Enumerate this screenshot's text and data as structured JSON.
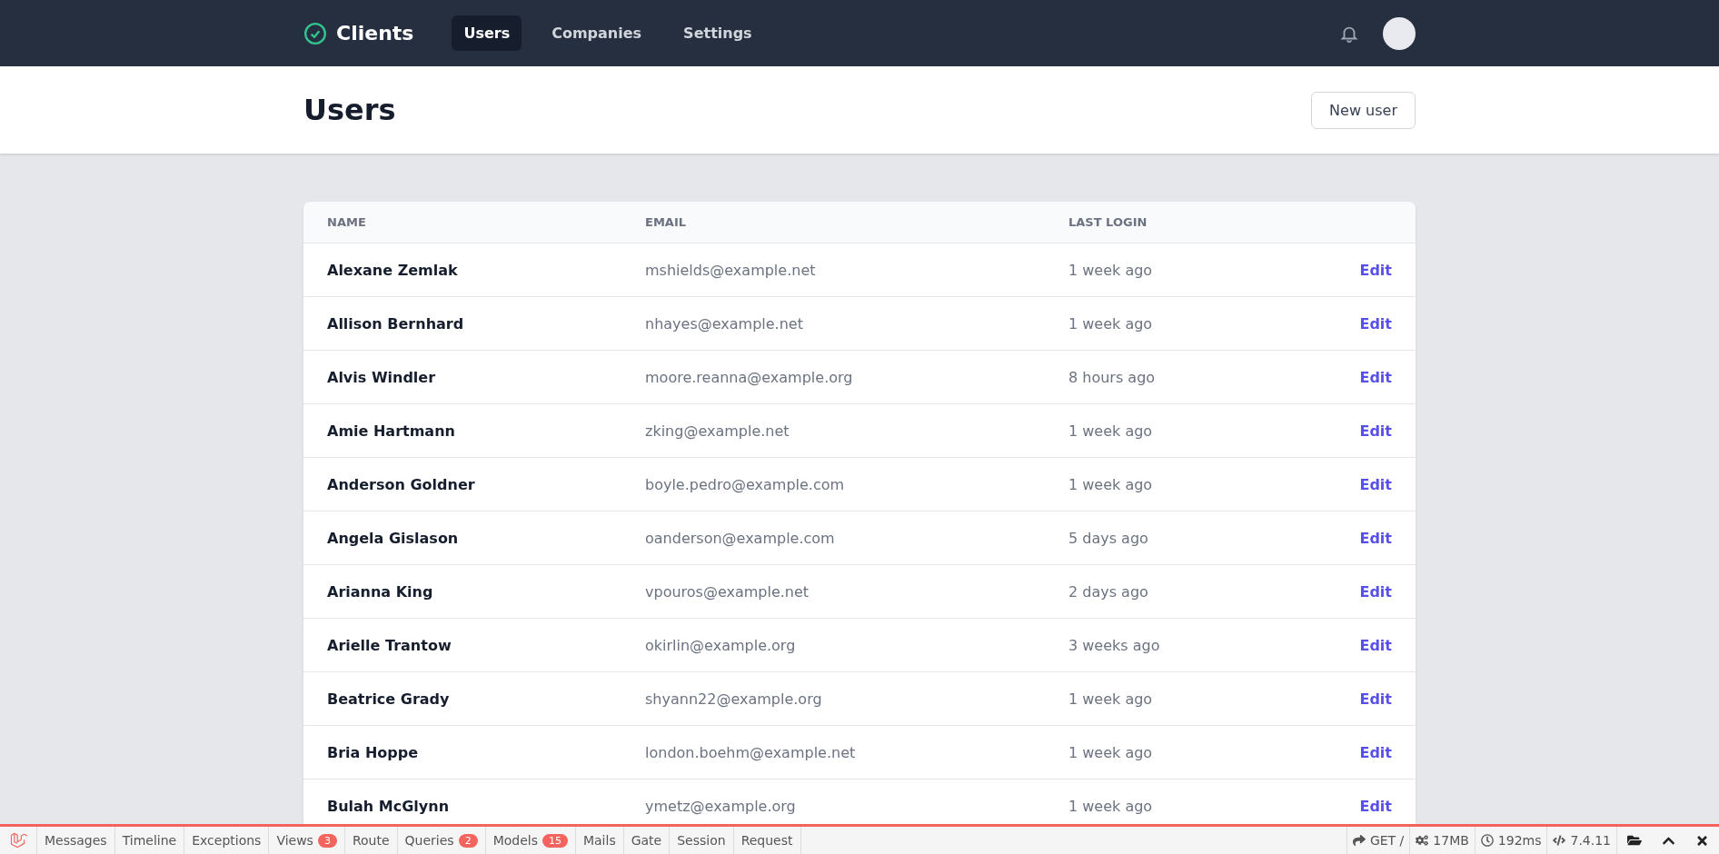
{
  "nav": {
    "brand": "Clients",
    "links": [
      {
        "label": "Users",
        "selected": true
      },
      {
        "label": "Companies",
        "selected": false
      },
      {
        "label": "Settings",
        "selected": false
      }
    ]
  },
  "page": {
    "title": "Users",
    "action": "New user"
  },
  "table": {
    "columns": [
      "NAME",
      "EMAIL",
      "LAST LOGIN"
    ],
    "rows": [
      {
        "name": "Alexane Zemlak",
        "email": "mshields@example.net",
        "last_login": "1 week ago",
        "action": "Edit"
      },
      {
        "name": "Allison Bernhard",
        "email": "nhayes@example.net",
        "last_login": "1 week ago",
        "action": "Edit"
      },
      {
        "name": "Alvis Windler",
        "email": "moore.reanna@example.org",
        "last_login": "8 hours ago",
        "action": "Edit"
      },
      {
        "name": "Amie Hartmann",
        "email": "zking@example.net",
        "last_login": "1 week ago",
        "action": "Edit"
      },
      {
        "name": "Anderson Goldner",
        "email": "boyle.pedro@example.com",
        "last_login": "1 week ago",
        "action": "Edit"
      },
      {
        "name": "Angela Gislason",
        "email": "oanderson@example.com",
        "last_login": "5 days ago",
        "action": "Edit"
      },
      {
        "name": "Arianna King",
        "email": "vpouros@example.net",
        "last_login": "2 days ago",
        "action": "Edit"
      },
      {
        "name": "Arielle Trantow",
        "email": "okirlin@example.org",
        "last_login": "3 weeks ago",
        "action": "Edit"
      },
      {
        "name": "Beatrice Grady",
        "email": "shyann22@example.org",
        "last_login": "1 week ago",
        "action": "Edit"
      },
      {
        "name": "Bria Hoppe",
        "email": "london.boehm@example.net",
        "last_login": "1 week ago",
        "action": "Edit"
      },
      {
        "name": "Bulah McGlynn",
        "email": "ymetz@example.org",
        "last_login": "1 week ago",
        "action": "Edit"
      }
    ]
  },
  "debugbar": {
    "tabs": [
      {
        "label": "Messages"
      },
      {
        "label": "Timeline"
      },
      {
        "label": "Exceptions"
      },
      {
        "label": "Views",
        "badge": "3"
      },
      {
        "label": "Route"
      },
      {
        "label": "Queries",
        "badge": "2"
      },
      {
        "label": "Models",
        "badge": "15"
      },
      {
        "label": "Mails"
      },
      {
        "label": "Gate"
      },
      {
        "label": "Session"
      },
      {
        "label": "Request"
      }
    ],
    "indicators": [
      {
        "kind": "request",
        "label": "GET /"
      },
      {
        "kind": "memory",
        "label": "17MB"
      },
      {
        "kind": "time",
        "label": "192ms"
      },
      {
        "kind": "php",
        "label": "7.4.11"
      }
    ]
  }
}
